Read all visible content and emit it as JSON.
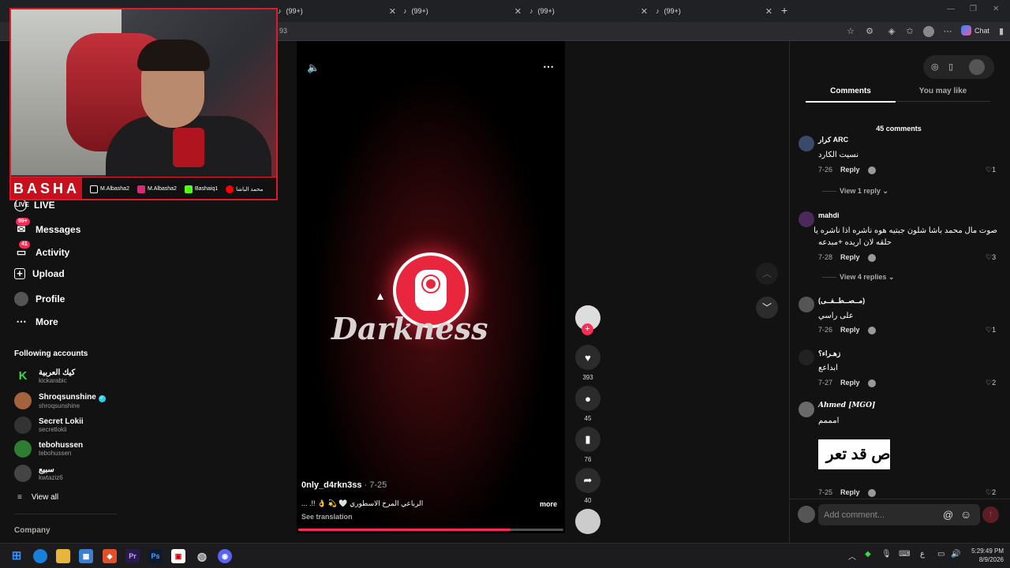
{
  "browser": {
    "tabs": [
      {
        "label": "(99+)"
      },
      {
        "label": "(99+)"
      },
      {
        "label": "(99+)"
      },
      {
        "label": "(99+)"
      }
    ],
    "url_fragment": "93",
    "chat_label": "Chat"
  },
  "webcam": {
    "brand": "BASHA",
    "socials": [
      "M.Albasha2",
      "M.Albasha2",
      "Bashaiq1",
      "محمد الباشا"
    ]
  },
  "sidebar": {
    "nav": [
      {
        "label": "LIVE",
        "icon": "live-icon"
      },
      {
        "label": "Messages",
        "icon": "messages-icon",
        "badge": "99+"
      },
      {
        "label": "Activity",
        "icon": "activity-icon",
        "badge": "41"
      },
      {
        "label": "Upload",
        "icon": "upload-icon"
      },
      {
        "label": "Profile",
        "icon": "profile-icon"
      },
      {
        "label": "More",
        "icon": "more-icon"
      }
    ],
    "following_title": "Following accounts",
    "accounts": [
      {
        "name": "كيك العربية",
        "handle": "kickarabic",
        "color": "#1a1a1a"
      },
      {
        "name": "Shroqsunshine",
        "handle": "shroqsunshine",
        "color": "#a4623d",
        "verified": true
      },
      {
        "name": "Secret Lokii",
        "handle": "secretlokii",
        "color": "#333333"
      },
      {
        "name": "tebohussen",
        "handle": "tebohussen",
        "color": "#2e7d32"
      },
      {
        "name": "سبيع",
        "handle": "kwtaziz6",
        "color": "#444444"
      }
    ],
    "view_all": "View all",
    "company": "Company"
  },
  "video": {
    "logo_text": "Darkness",
    "username": "0nly_d4rkn3ss",
    "date": "· 7-25",
    "caption": "الرباعي المرح الاسطوري 🤍 💫 👌 !!. ...",
    "more": "more",
    "see_translation": "See translation",
    "progress": 0.8,
    "likes": "393",
    "comments": "45",
    "saves": "76",
    "shares": "40"
  },
  "comments_panel": {
    "tab_comments": "Comments",
    "tab_may_like": "You may like",
    "count_label": "45 comments",
    "reply_label": "Reply",
    "items": [
      {
        "user": "كرار ARC",
        "text": "نسيت الكارد",
        "date": "7-26",
        "likes": "1",
        "view": "View 1 reply",
        "avcolor": "#3a4a6a"
      },
      {
        "user": "mahdi",
        "text": "صوت مال محمد باشا شلون جبتيه هوه ناشره اذا ناشره يا",
        "text2": "حلقه لان اريده +مبدعه",
        "date": "7-28",
        "likes": "3",
        "view": "View 4 replies",
        "avcolor": "#4a2a5a"
      },
      {
        "user": "(مــصــطــفــى)",
        "text": "على راسي",
        "date": "7-26",
        "likes": "1",
        "avcolor": "#555555"
      },
      {
        "user": "زهـراء؟",
        "text": "ابداعع",
        "date": "7-27",
        "likes": "2",
        "avcolor": "#222222"
      },
      {
        "user": "Ahmed [MGO]",
        "text": "امممم",
        "sticker": "اص قد تعر",
        "date": "7-25",
        "likes": "2",
        "avcolor": "#6a6a6a"
      }
    ],
    "add_placeholder": "Add comment..."
  },
  "taskbar": {
    "time": "5:29:49 PM",
    "date": "8/9/2026",
    "lang": "ع"
  }
}
